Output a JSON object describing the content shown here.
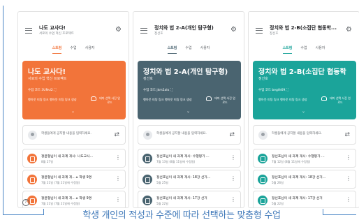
{
  "caption": "학생 개인의 적성과 수준에 따라 선택하는 맞춤형 수업",
  "colors": {
    "orange": "#f2743a",
    "slate": "#4a6470",
    "teal": "#1ba49a",
    "frame": "#4a86c5"
  },
  "icons": {
    "menu": "hamburger-menu-icon",
    "settings": "gear-icon",
    "repost": "repost-icon",
    "more": "more-vert-icon",
    "assignment": "assignment-icon",
    "help": "help-icon",
    "upload": "upload-photo-icon"
  },
  "phones": [
    {
      "app_title": "나도 교사다!",
      "app_subtitle": "서로의 수업 혁신 프로젝트",
      "tabs": [
        "스트림",
        "수업",
        "사용자"
      ],
      "banner": {
        "title": "나도 교사다!",
        "subtitle": "서로의 수업 혁신 프로젝트",
        "code": "수업 코드 3UNvi2 ⛶",
        "links": "행아웃 미팅 링크  행아웃 미팅 링크 생성",
        "upload": "테마 선택 사진 업로드",
        "chevron": "⌄"
      },
      "announce_text": "학생들에게 공지할 내용을 입력하세요.",
      "posts": [
        {
          "title": "정윤형님이 새 과제 게시: 나도교사...",
          "date": "8월 27일"
        },
        {
          "title": "정윤형님이 새 과제 게...  ▸ 학생 9명",
          "date": "7월 21일 (7월 21일에 수정됨)"
        },
        {
          "title": "정윤형님이 새 과제 게...  ▸ 학생 9명",
          "date": "7월 21일 (7월 21일에 수정됨)"
        }
      ]
    },
    {
      "app_title": "정치와 법 2-A(개인 탐구형)",
      "app_subtitle": "정선호",
      "tabs": [
        "스트림",
        "수업",
        "사용자"
      ],
      "banner": {
        "title": "정치와 법 2-A(개인 탐구형)",
        "subtitle": "정선호",
        "code": "수업 코드 jkm2alo ⛶",
        "links": "행아웃 미팅 링크  행아웃 미팅 링크 생성",
        "upload": "테마 선택 사진 업로드",
        "chevron": "⌄"
      },
      "announce_text": "학생들에게 공지할 내용을 입력하세요.",
      "posts": [
        {
          "title": "정선호님이 새 과제 게시: 수행평가 ...",
          "date": "7월 13일 (8월 11일에 수정됨)"
        },
        {
          "title": "정선호님이 새 과제 게시: 18강 선거...",
          "date": "5월 25일"
        },
        {
          "title": "정선호님이 새 과제 게시: 17강 선거",
          "date": "5월 22일"
        }
      ]
    },
    {
      "app_title": "정치와 법 2-B(소집단 협동학...",
      "app_subtitle": "정선호",
      "tabs": [
        "스트림",
        "수업",
        "사용자"
      ],
      "banner": {
        "title": "정치와 법 2-B(소집단 협동학",
        "subtitle": "정선호",
        "code": "수업 코드 begth69 ⛶",
        "links": "행아웃 미팅 링크  행아웃 미팅 링크 생성",
        "upload": "테마 선택 사진 업로드",
        "chevron": "⌄"
      },
      "announce_text": "학생들에게 공지할 내용을 입력하세요.",
      "posts": [
        {
          "title": "정선호님이 새 과제 게시: 수행평가 ...",
          "date": "7월 12일 (8월 11일에 수정됨)"
        },
        {
          "title": "정선호님이 새 과제 게시: 18강 선거...",
          "date": "5월 26일"
        },
        {
          "title": "정선호님이 새 과제 게시: 17강 선거",
          "date": "5월 22일"
        }
      ]
    }
  ]
}
